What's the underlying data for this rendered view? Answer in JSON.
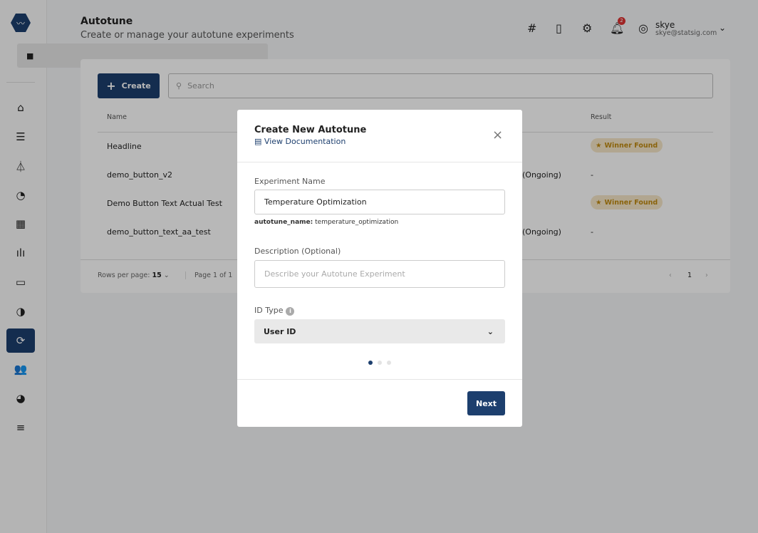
{
  "sidebar": {
    "items": [
      "folder",
      "home",
      "sliders",
      "flask",
      "gauge",
      "dashboard",
      "audio-wave",
      "feature-flags",
      "segments",
      "autotune",
      "users",
      "analytics",
      "search-list"
    ],
    "active": "autotune"
  },
  "header": {
    "title": "Autotune",
    "subtitle": "Create or manage your autotune experiments",
    "user_name": "skye",
    "user_email": "skye@statsig.com",
    "notification_count": "2"
  },
  "toolbar": {
    "create_label": "Create",
    "search_placeholder": "Search"
  },
  "table": {
    "columns": {
      "name": "Name",
      "result": "Result"
    },
    "rows": [
      {
        "name": "Headline",
        "status": "",
        "result": "Winner Found"
      },
      {
        "name": "demo_button_v2",
        "status": "(Ongoing)",
        "result": "-"
      },
      {
        "name": "Demo Button Text Actual Test",
        "status": "",
        "result": "Winner Found"
      },
      {
        "name": "demo_button_text_aa_test",
        "status": "(Ongoing)",
        "result": "-"
      }
    ]
  },
  "footer": {
    "rows_label": "Rows per page:",
    "rows_value": "15",
    "page_text": "Page 1 of 1",
    "current_page": "1"
  },
  "modal": {
    "title": "Create New Autotune",
    "doc_link": "View Documentation",
    "name_label": "Experiment Name",
    "name_value": "Temperature Optimization",
    "hint_key": "autotune_name:",
    "hint_value": "temperature_optimization",
    "desc_label": "Description (Optional)",
    "desc_placeholder": "Describe your Autotune Experiment",
    "id_label": "ID Type",
    "id_value": "User ID",
    "step": "1 of 3",
    "next_label": "Next"
  },
  "colors": {
    "primary": "#1d3f6e",
    "winner": "#c08a10",
    "badge": "#dd3333"
  }
}
